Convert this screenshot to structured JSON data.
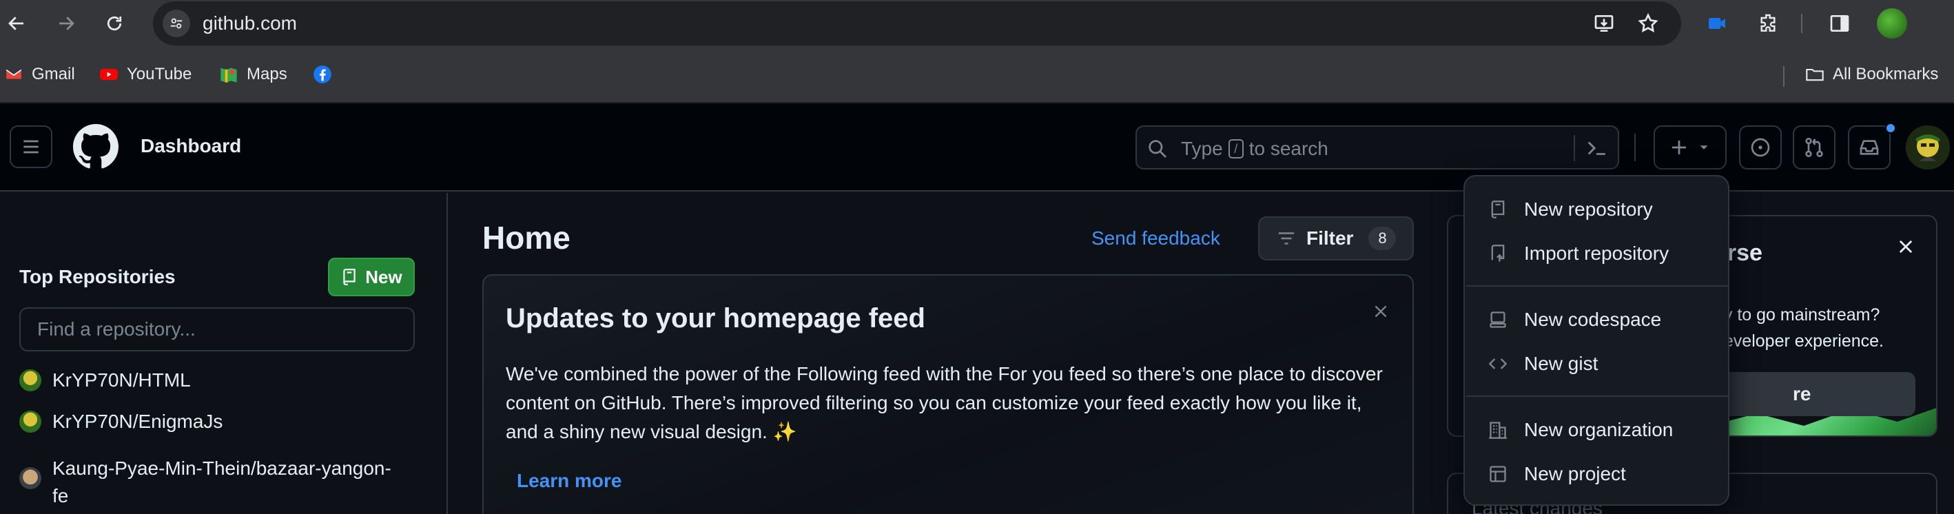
{
  "browser": {
    "url": "github.com",
    "bookmarks": [
      {
        "label": "Gmail",
        "icon": "gmail-icon"
      },
      {
        "label": "YouTube",
        "icon": "youtube-icon"
      },
      {
        "label": "Maps",
        "icon": "maps-icon"
      },
      {
        "label": "",
        "icon": "facebook-icon"
      }
    ],
    "all_bookmarks_label": "All Bookmarks"
  },
  "header": {
    "title": "Dashboard",
    "search_placeholder_pre": "Type",
    "search_key": "/",
    "search_placeholder_post": "to search"
  },
  "sidebar": {
    "title": "Top Repositories",
    "new_button": "New",
    "find_placeholder": "Find a repository...",
    "repos": [
      {
        "name": "KrYP70N/HTML"
      },
      {
        "name": "KrYP70N/EnigmaJs"
      },
      {
        "name": "Kaung-Pyae-Min-Thein/bazaar-yangon-\nfe"
      }
    ]
  },
  "main": {
    "title": "Home",
    "send_feedback": "Send feedback",
    "filter_label": "Filter",
    "filter_count": "8",
    "feed_card": {
      "title": "Updates to your homepage feed",
      "body": "We've combined the power of the Following feed with the For you feed so there’s one place to discover content on GitHub. There’s improved filtering so you can customize your feed exactly how you like it, and a shiny new visual design. ✨",
      "learn_more": "Learn more"
    }
  },
  "right_column": {
    "card_title_fragment": "erse",
    "card_text_line1": "gy to go mainstream?",
    "card_text_line2": "developer experience.",
    "card_button_fragment": "re",
    "card2_title_fragment": "Latest changes"
  },
  "create_menu": {
    "items": [
      {
        "label": "New repository",
        "icon": "repo-icon"
      },
      {
        "label": "Import repository",
        "icon": "repo-push-icon"
      },
      {
        "label": "New codespace",
        "icon": "codespaces-icon"
      },
      {
        "label": "New gist",
        "icon": "code-icon"
      },
      {
        "label": "New organization",
        "icon": "organization-icon"
      },
      {
        "label": "New project",
        "icon": "table-icon"
      }
    ]
  },
  "colors": {
    "accent_blue": "#4493f8",
    "primary_green": "#238636",
    "background": "#0d1117",
    "header_bg": "#010409",
    "border": "#30363d"
  }
}
